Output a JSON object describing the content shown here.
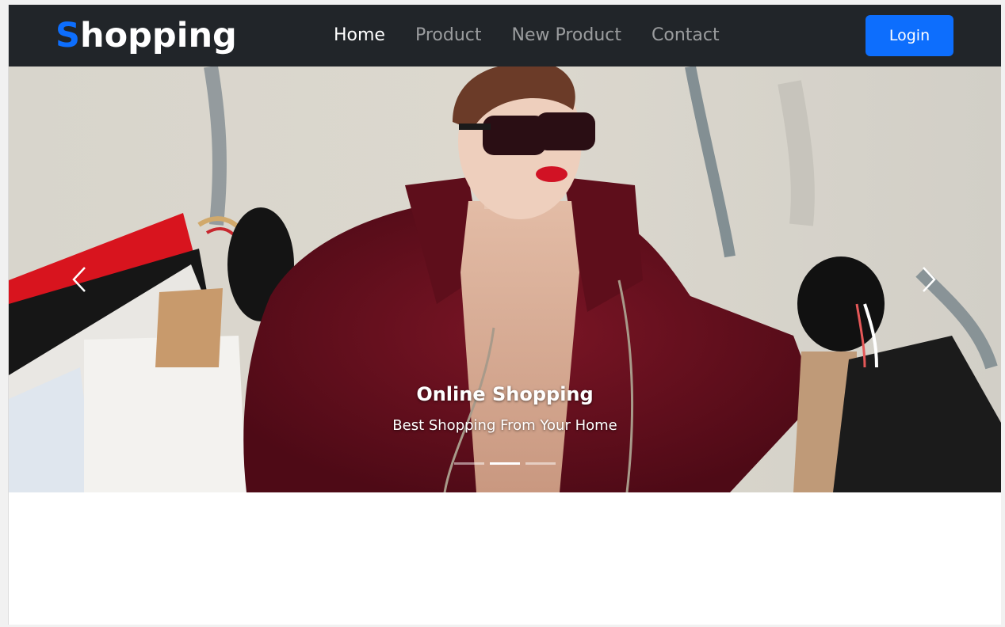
{
  "navbar": {
    "brand_first": "S",
    "brand_rest": "hopping",
    "links": [
      {
        "label": "Home",
        "active": true
      },
      {
        "label": "Product",
        "active": false
      },
      {
        "label": "New Product",
        "active": false
      },
      {
        "label": "Contact",
        "active": false
      }
    ],
    "login_label": "Login"
  },
  "carousel": {
    "caption_title": "Online Shopping",
    "caption_subtitle": "Best Shopping From Your Home",
    "slide_count": 3,
    "active_slide": 2
  },
  "colors": {
    "navbar_bg": "#212529",
    "brand_accent": "#0d6efd",
    "login_button": "#0d6efd"
  },
  "icons": {
    "prev": "chevron-left-icon",
    "next": "chevron-right-icon"
  }
}
